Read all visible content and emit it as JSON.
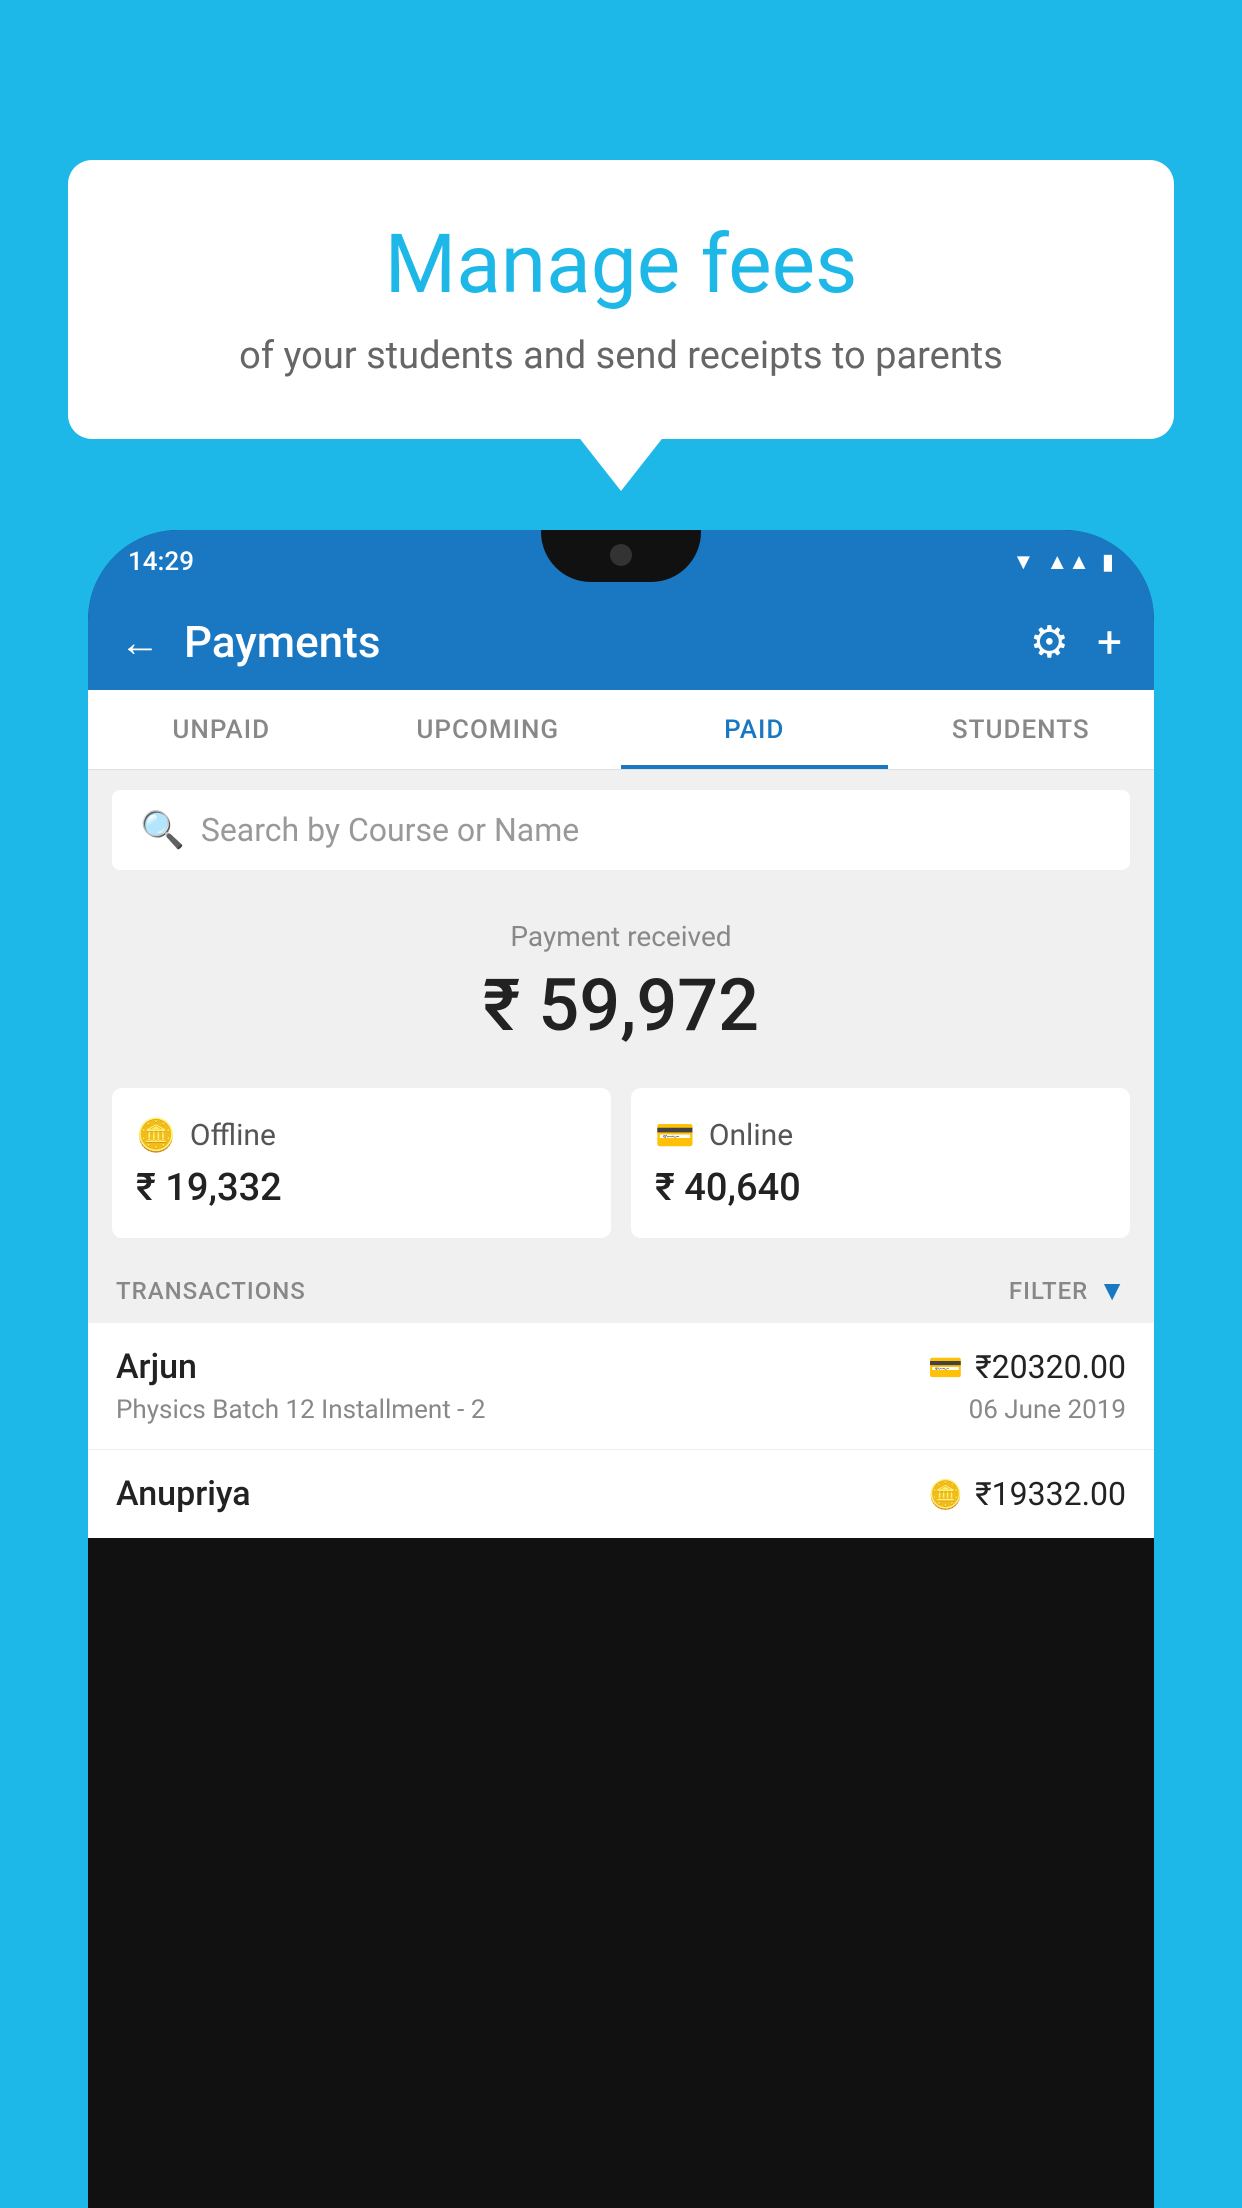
{
  "background_color": "#1eb8e8",
  "bubble": {
    "title": "Manage fees",
    "subtitle": "of your students and send receipts to parents"
  },
  "status_bar": {
    "time": "14:29",
    "icons": [
      "wifi",
      "signal",
      "battery"
    ]
  },
  "app_bar": {
    "title": "Payments",
    "back_label": "←",
    "gear_label": "⚙",
    "plus_label": "+"
  },
  "tabs": [
    {
      "label": "UNPAID",
      "active": false
    },
    {
      "label": "UPCOMING",
      "active": false
    },
    {
      "label": "PAID",
      "active": true
    },
    {
      "label": "STUDENTS",
      "active": false
    }
  ],
  "search": {
    "placeholder": "Search by Course or Name"
  },
  "payment_received": {
    "label": "Payment received",
    "amount": "₹ 59,972"
  },
  "payment_cards": [
    {
      "icon": "💳",
      "label": "Offline",
      "amount": "₹ 19,332"
    },
    {
      "icon": "💳",
      "label": "Online",
      "amount": "₹ 40,640"
    }
  ],
  "transactions_section": {
    "label": "TRANSACTIONS",
    "filter_label": "FILTER"
  },
  "transactions": [
    {
      "name": "Arjun",
      "course": "Physics Batch 12 Installment - 2",
      "amount": "₹20320.00",
      "date": "06 June 2019",
      "payment_type": "card"
    },
    {
      "name": "Anupriya",
      "course": "",
      "amount": "₹19332.00",
      "date": "",
      "payment_type": "offline"
    }
  ]
}
